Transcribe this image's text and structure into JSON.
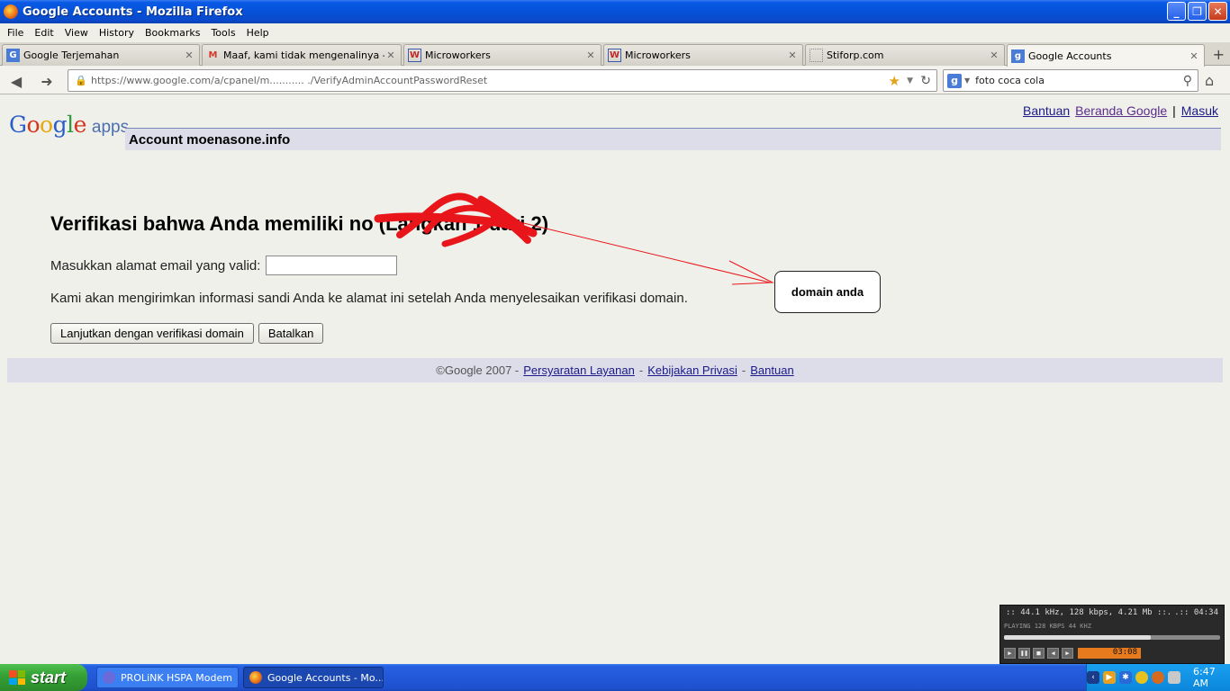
{
  "window": {
    "title": "Google Accounts - Mozilla Firefox",
    "buttons": {
      "minimize": "_",
      "maximize": "❐",
      "close": "✕"
    }
  },
  "menubar": [
    "File",
    "Edit",
    "View",
    "History",
    "Bookmarks",
    "Tools",
    "Help"
  ],
  "tabs": [
    {
      "label": "Google Terjemahan",
      "icon": "google-translate-icon",
      "glyph": "G",
      "active": false
    },
    {
      "label": "Maaf, kami tidak mengenalinya - riy...",
      "icon": "gmail-icon",
      "glyph": "M",
      "active": false
    },
    {
      "label": "Microworkers",
      "icon": "microworkers-icon",
      "glyph": "W",
      "active": false
    },
    {
      "label": "Microworkers",
      "icon": "microworkers-icon",
      "glyph": "W",
      "active": false
    },
    {
      "label": "Stiforp.com",
      "icon": "blank-page-icon",
      "glyph": "",
      "active": false
    },
    {
      "label": "Google Accounts",
      "icon": "google-icon",
      "glyph": "g",
      "active": true
    }
  ],
  "navbar": {
    "url": "https://www.google.com/a/cpanel/m...........  ./VerifyAdminAccountPasswordReset",
    "search_value": "foto coca cola"
  },
  "page": {
    "logo_google": "Google",
    "logo_apps": "apps",
    "links": {
      "help": "Bantuan",
      "home": "Beranda Google",
      "signin": "Masuk",
      "sep": "|"
    },
    "account_title": "Account moenasone.info",
    "heading": "Verifikasi bahwa Anda memiliki               no (Langkah 1 dari 2)",
    "email_label": "Masukkan alamat email yang valid:",
    "info_text": "Kami akan mengirimkan informasi sandi Anda ke alamat ini setelah Anda menyelesaikan verifikasi domain.",
    "continue_button": "Lanjutkan dengan verifikasi domain",
    "cancel_button": "Batalkan",
    "callout_text": "domain anda",
    "footer": {
      "copyright": "©Google 2007 -",
      "terms": "Persyaratan Layanan",
      "privacy": "Kebijakan Privasi",
      "help": "Bantuan",
      "dash": "-"
    }
  },
  "player": {
    "info": ":: 44.1 kHz, 128 kbps, 4.21 Mb ::.",
    "total_time": ".:: 04:34",
    "status": "PLAYING     128 KBPS       44 KHZ",
    "elapsed": "03:08",
    "progress": 0.68
  },
  "taskbar": {
    "start": "start",
    "items": [
      {
        "label": "PROLiNK HSPA Modem"
      },
      {
        "label": "Google Accounts - Mo..."
      }
    ],
    "clock": "6:47 AM"
  },
  "colors": {
    "accent_bar": "#dcdde8",
    "link": "#1a1a8a",
    "scribble": "#e8151b",
    "arrow": "#e8151b"
  }
}
